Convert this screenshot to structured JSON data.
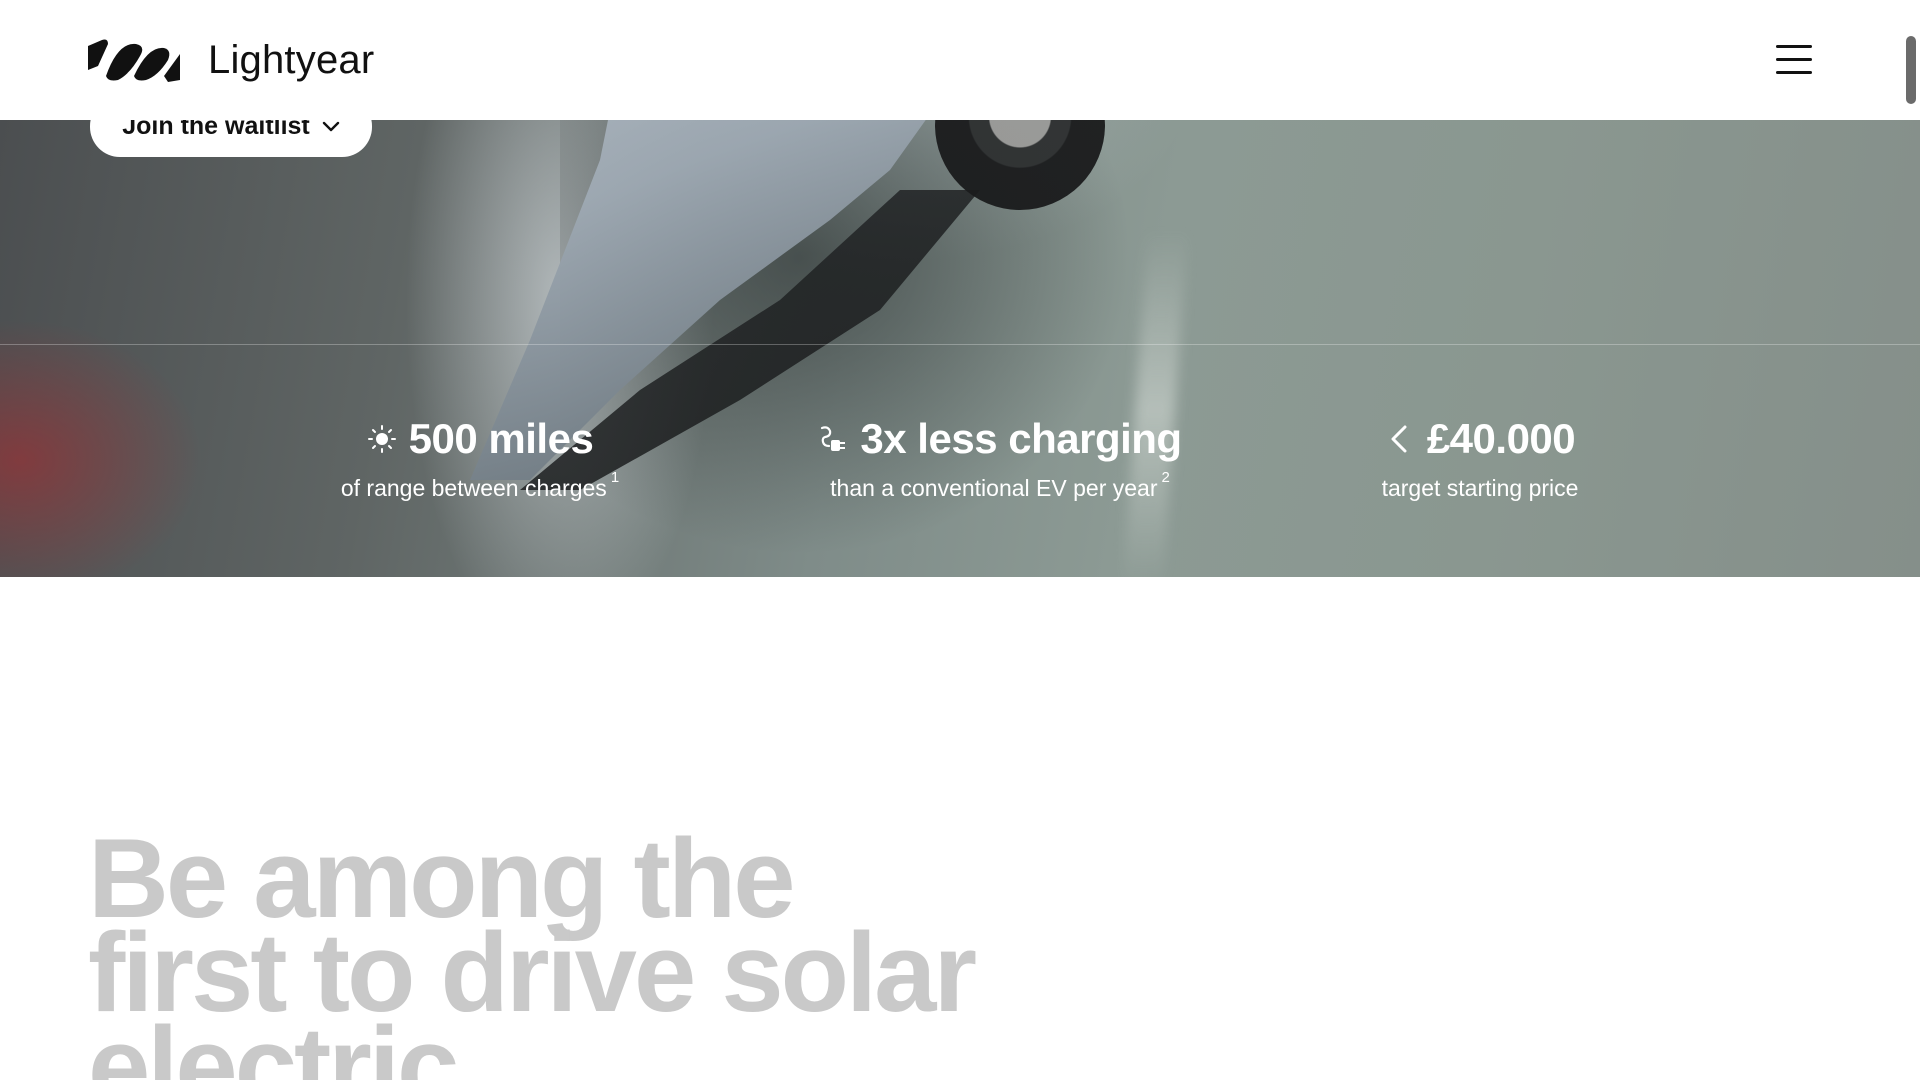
{
  "navbar": {
    "brand": "Lightyear",
    "logo_icon": "lightyear-logo-icon",
    "menu_icon": "hamburger-menu-icon"
  },
  "hero": {
    "waitlist_button": "Join the waitlist",
    "waitlist_icon": "chevron-down-icon",
    "stats": [
      {
        "icon": "sun-icon",
        "value": "500 miles",
        "label": "of range between charges",
        "footnote": "1"
      },
      {
        "icon": "charging-plug-icon",
        "value": "3x less charging",
        "label": "than a conventional EV per year",
        "footnote": "2"
      },
      {
        "icon": "chevron-left-icon",
        "value": "£40.000",
        "label": "target starting price",
        "footnote": ""
      }
    ]
  },
  "headline": {
    "line1": "Be among the",
    "line2": "first to drive solar",
    "line3": "electric"
  },
  "colors": {
    "headline_text": "#c9c9c9",
    "background": "#ffffff",
    "hero_tint": "#8a9790"
  }
}
